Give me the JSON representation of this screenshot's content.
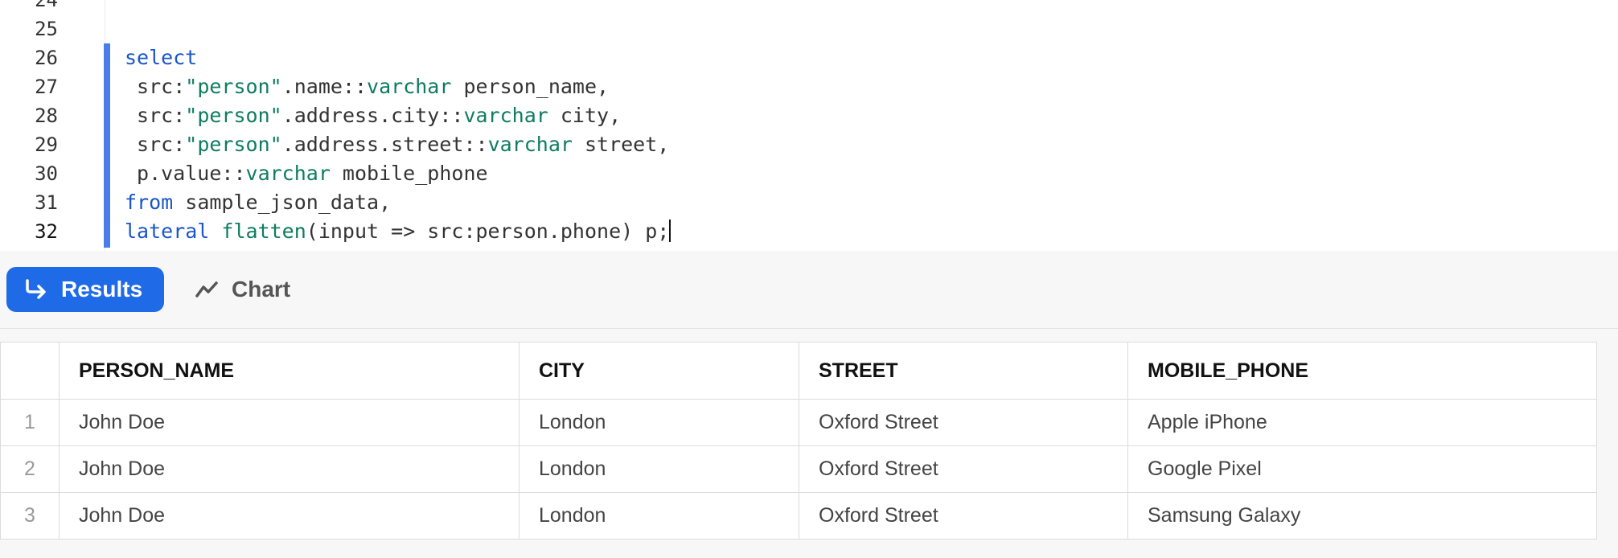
{
  "editor": {
    "partial_line_number": "24",
    "line_numbers": [
      "25",
      "26",
      "27",
      "28",
      "29",
      "30",
      "31",
      "32"
    ],
    "current_line": "32",
    "lines": [
      [],
      [
        {
          "t": "select",
          "k": "kw"
        }
      ],
      [
        {
          "t": " src:",
          "k": "plain"
        },
        {
          "t": "\"person\"",
          "k": "str"
        },
        {
          "t": ".name::",
          "k": "plain"
        },
        {
          "t": "varchar",
          "k": "type"
        },
        {
          "t": " person_name,",
          "k": "plain"
        }
      ],
      [
        {
          "t": " src:",
          "k": "plain"
        },
        {
          "t": "\"person\"",
          "k": "str"
        },
        {
          "t": ".address.city::",
          "k": "plain"
        },
        {
          "t": "varchar",
          "k": "type"
        },
        {
          "t": " city,",
          "k": "plain"
        }
      ],
      [
        {
          "t": " src:",
          "k": "plain"
        },
        {
          "t": "\"person\"",
          "k": "str"
        },
        {
          "t": ".address.street::",
          "k": "plain"
        },
        {
          "t": "varchar",
          "k": "type"
        },
        {
          "t": " street,",
          "k": "plain"
        }
      ],
      [
        {
          "t": " p.value::",
          "k": "plain"
        },
        {
          "t": "varchar",
          "k": "type"
        },
        {
          "t": " mobile_phone",
          "k": "plain"
        }
      ],
      [
        {
          "t": "from",
          "k": "kw"
        },
        {
          "t": " sample_json_data,",
          "k": "plain"
        }
      ],
      [
        {
          "t": "lateral",
          "k": "kw"
        },
        {
          "t": " ",
          "k": "plain"
        },
        {
          "t": "flatten",
          "k": "fn"
        },
        {
          "t": "(input => src:person.phone) p;",
          "k": "plain"
        }
      ]
    ]
  },
  "tabs": {
    "results_label": "Results",
    "chart_label": "Chart"
  },
  "results": {
    "columns": [
      "PERSON_NAME",
      "CITY",
      "STREET",
      "MOBILE_PHONE"
    ],
    "rows": [
      {
        "num": "1",
        "cells": [
          "John Doe",
          "London",
          "Oxford Street",
          "Apple iPhone"
        ]
      },
      {
        "num": "2",
        "cells": [
          "John Doe",
          "London",
          "Oxford Street",
          "Google Pixel"
        ]
      },
      {
        "num": "3",
        "cells": [
          "John Doe",
          "London",
          "Oxford Street",
          "Samsung Galaxy"
        ]
      }
    ]
  },
  "colors": {
    "accent": "#1f6ae6",
    "active_bar": "#4a7de8",
    "keyword": "#1a56c9",
    "string": "#0e7c61"
  }
}
